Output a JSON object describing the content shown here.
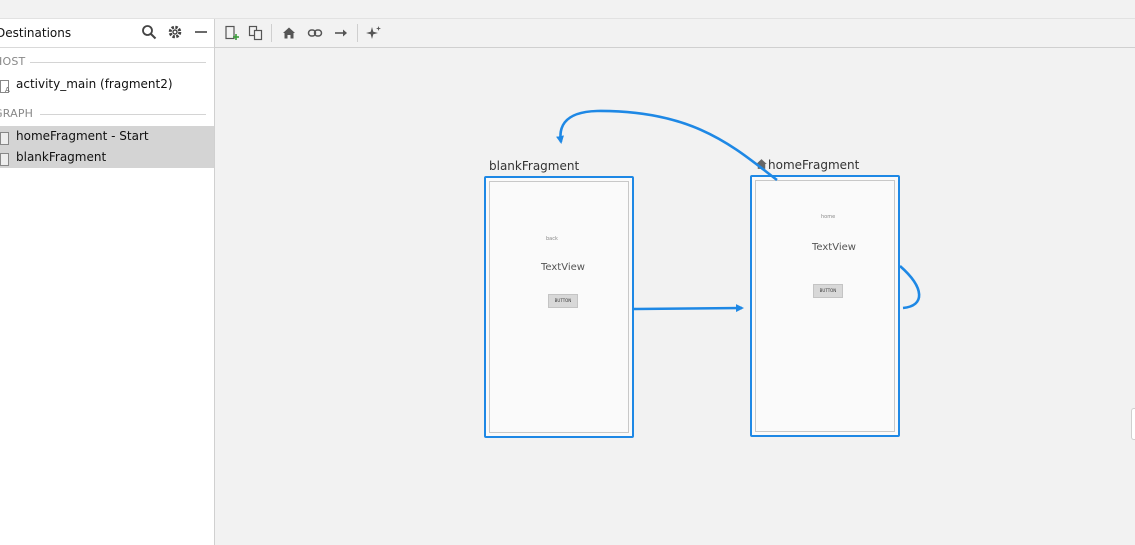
{
  "left_panel": {
    "title": "Destinations",
    "host_section": "HOST",
    "host_item": "activity_main (fragment2)",
    "graph_section": "GRAPH",
    "graph_items": [
      {
        "label": "homeFragment - Start",
        "selected": true
      },
      {
        "label": "blankFragment",
        "selected": true
      }
    ]
  },
  "icons": {
    "search": "search-icon",
    "settings": "gear-icon",
    "minimize": "minimize-icon",
    "new_destination": "new-destination-icon",
    "nested_graph": "nested-graph-icon",
    "start_destination": "home-icon",
    "deep_link": "link-icon",
    "action": "arrow-right-icon",
    "auto_arrange": "sparkle-icon"
  },
  "graph": {
    "blank": {
      "title": "blankFragment",
      "small_text": "back",
      "textview": "TextView",
      "button": "BUTTON"
    },
    "home": {
      "title": "homeFragment",
      "small_text": "home",
      "textview": "TextView",
      "button": "BUTTON"
    }
  },
  "colors": {
    "accent": "#1e88e5",
    "selection": "#d4d4d4"
  }
}
